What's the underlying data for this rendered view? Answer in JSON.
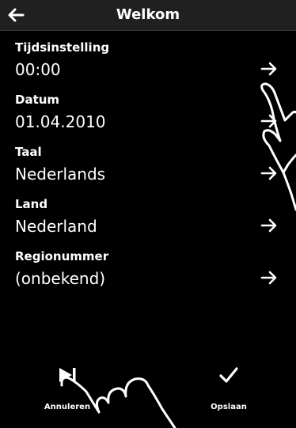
{
  "header": {
    "title": "Welkom",
    "back_icon": "arrow-left-icon"
  },
  "settings": [
    {
      "label": "Tijdsinstelling",
      "value": "00:00"
    },
    {
      "label": "Datum",
      "value": "01.04.2010"
    },
    {
      "label": "Taal",
      "value": "Nederlands"
    },
    {
      "label": "Land",
      "value": "Nederland"
    },
    {
      "label": "Regionummer",
      "value": "(onbekend)"
    }
  ],
  "footer": {
    "cancel_label": "Annuleren",
    "cancel_icon": "skip-next-icon",
    "save_label": "Opslaan",
    "save_icon": "checkmark-icon"
  },
  "colors": {
    "background": "#000000",
    "header": "#202020",
    "text": "#ffffff"
  }
}
